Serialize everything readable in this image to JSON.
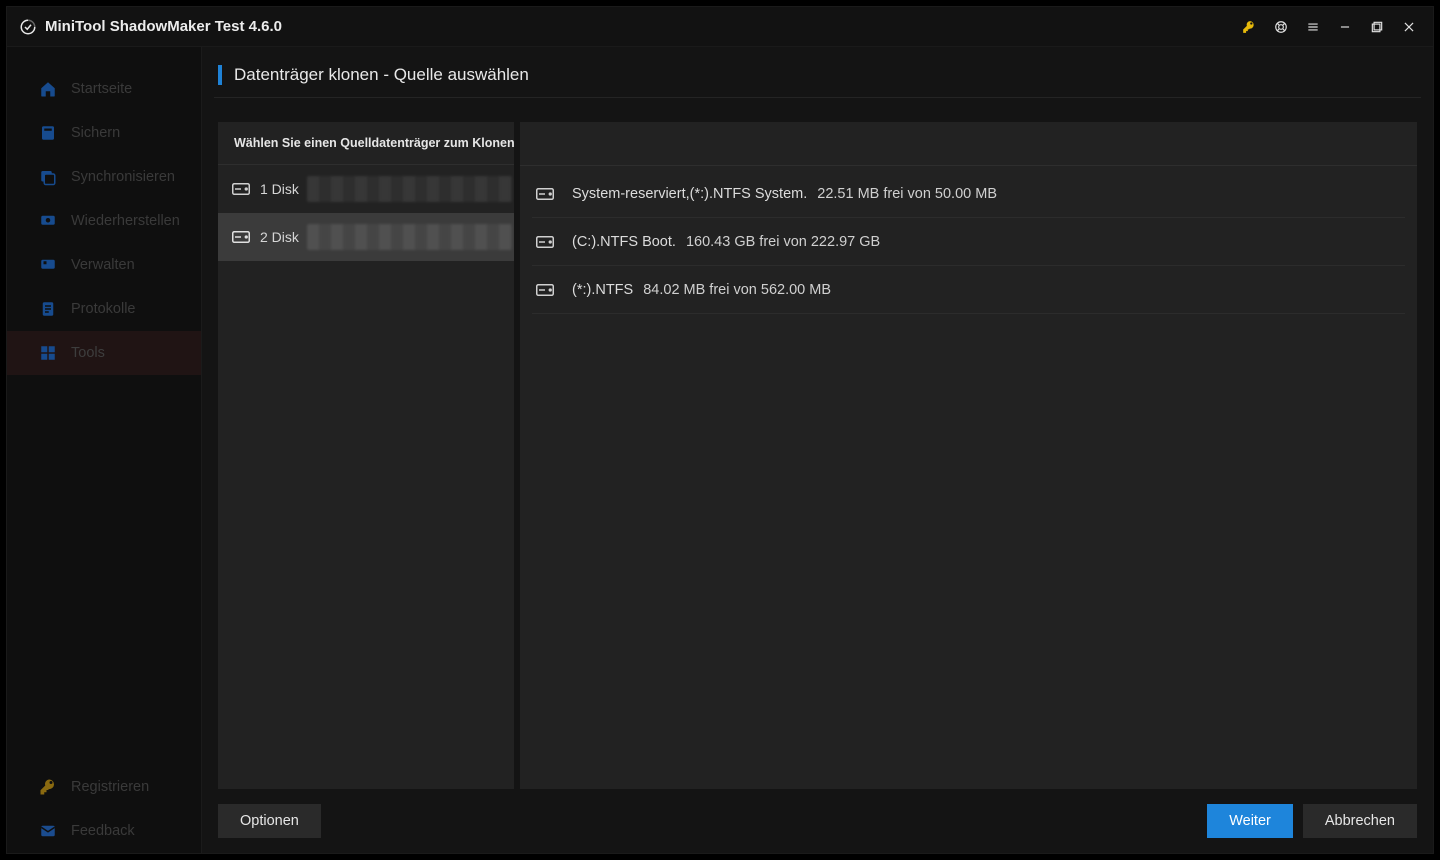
{
  "app_title": "MiniTool ShadowMaker Test 4.6.0",
  "sidebar": {
    "items": [
      {
        "label": "Startseite"
      },
      {
        "label": "Sichern"
      },
      {
        "label": "Synchronisieren"
      },
      {
        "label": "Wiederherstellen"
      },
      {
        "label": "Verwalten"
      },
      {
        "label": "Protokolle"
      },
      {
        "label": "Tools"
      }
    ],
    "bottom": [
      {
        "label": "Registrieren"
      },
      {
        "label": "Feedback"
      }
    ]
  },
  "page": {
    "title": "Datenträger klonen -  Quelle auswählen",
    "left_header": "Wählen Sie einen Quelldatenträger zum Klonen aus",
    "disks": [
      {
        "label": "1 Disk"
      },
      {
        "label": "2 Disk"
      }
    ],
    "partitions": [
      {
        "name": "System-reserviert,(*:).NTFS System.",
        "info": "22.51 MB frei von 50.00 MB"
      },
      {
        "name": "(C:).NTFS Boot.",
        "info": "160.43 GB frei von 222.97 GB"
      },
      {
        "name": "(*:).NTFS",
        "info": "84.02 MB frei von 562.00 MB"
      }
    ]
  },
  "footer": {
    "options": "Optionen",
    "next": "Weiter",
    "cancel": "Abbrechen"
  }
}
